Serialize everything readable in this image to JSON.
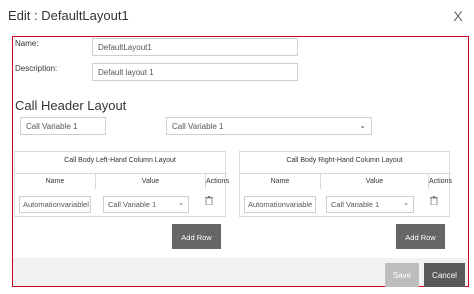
{
  "dialog": {
    "title": "Edit : DefaultLayout1",
    "close_icon": "close-icon",
    "close_glyph": "X"
  },
  "form": {
    "name_label": "Name:",
    "name_value": "DefaultLayout1",
    "description_label": "Description:",
    "description_value": "Default layout 1"
  },
  "call_header": {
    "title": "Call Header Layout",
    "field_value": "Call Variable 1",
    "select_value": "Call Variable 1"
  },
  "left_table": {
    "caption": "Call Body Left-Hand Column Layout",
    "headers": [
      "Name",
      "Value",
      "Actions"
    ],
    "rows": [
      {
        "name": "Automationvariablel",
        "value": "Call Variable 1",
        "action_icon": "trash-icon"
      }
    ],
    "add_row_label": "Add Row"
  },
  "right_table": {
    "caption": "Call Body Right-Hand Column Layout",
    "headers": [
      "Name",
      "Value",
      "Actions"
    ],
    "rows": [
      {
        "name": "Automationvariable",
        "value": "Call Variable 1",
        "action_icon": "trash-icon"
      }
    ],
    "add_row_label": "Add Row"
  },
  "footer": {
    "save_label": "Save",
    "cancel_label": "Cancel"
  },
  "colors": {
    "highlight_border": "#d0021b",
    "button_dark": "#666666",
    "save_disabled": "#bdbdbd",
    "cancel": "#595959"
  }
}
